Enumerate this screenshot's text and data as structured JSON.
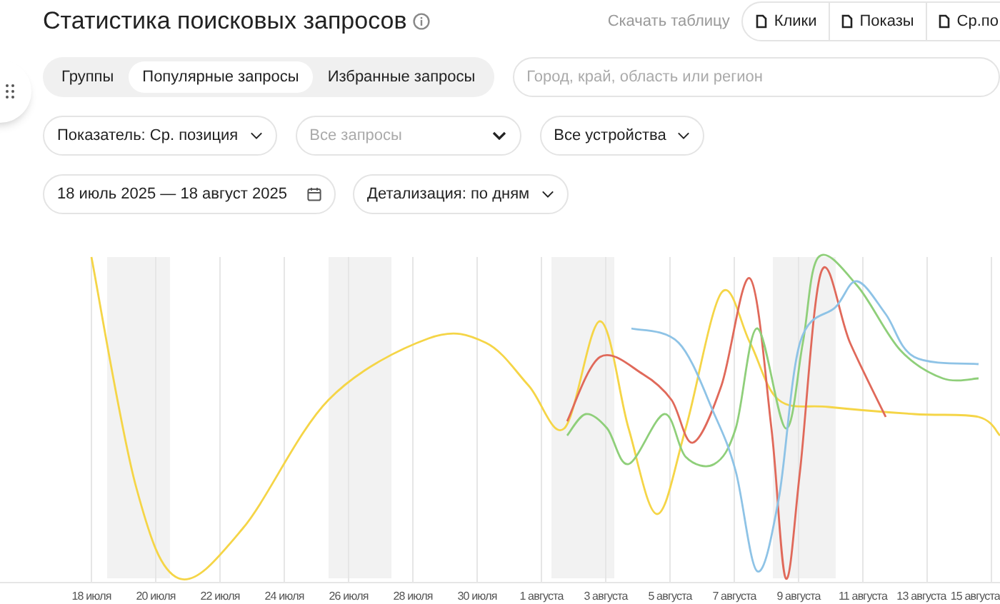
{
  "title": "Статистика поисковых запросов",
  "download_label": "Скачать таблицу",
  "export_buttons": [
    "Клики",
    "Показы",
    "Ср.по"
  ],
  "segments": [
    {
      "label": "Группы",
      "selected": false
    },
    {
      "label": "Популярные запросы",
      "selected": true
    },
    {
      "label": "Избранные запросы",
      "selected": false
    }
  ],
  "region_search": {
    "placeholder": "Город, край, область или регион"
  },
  "filters": [
    {
      "kind": "value",
      "text": "Показатель: Ср. позиция"
    },
    {
      "kind": "placeholder",
      "text": "Все запросы"
    },
    {
      "kind": "value",
      "text": "Все устройства"
    }
  ],
  "date_range": "18 июль 2025 — 18 август 2025",
  "detail_select": "Детализация: по дням",
  "chart": {
    "x_labels": [
      "18 июля",
      "20 июля",
      "22 июля",
      "24 июля",
      "26 июля",
      "28 июля",
      "30 июля",
      "1 августа",
      "3 августа",
      "5 августа",
      "7 августа",
      "9 августа",
      "11 августа",
      "13 августа",
      "15 августа"
    ]
  }
}
